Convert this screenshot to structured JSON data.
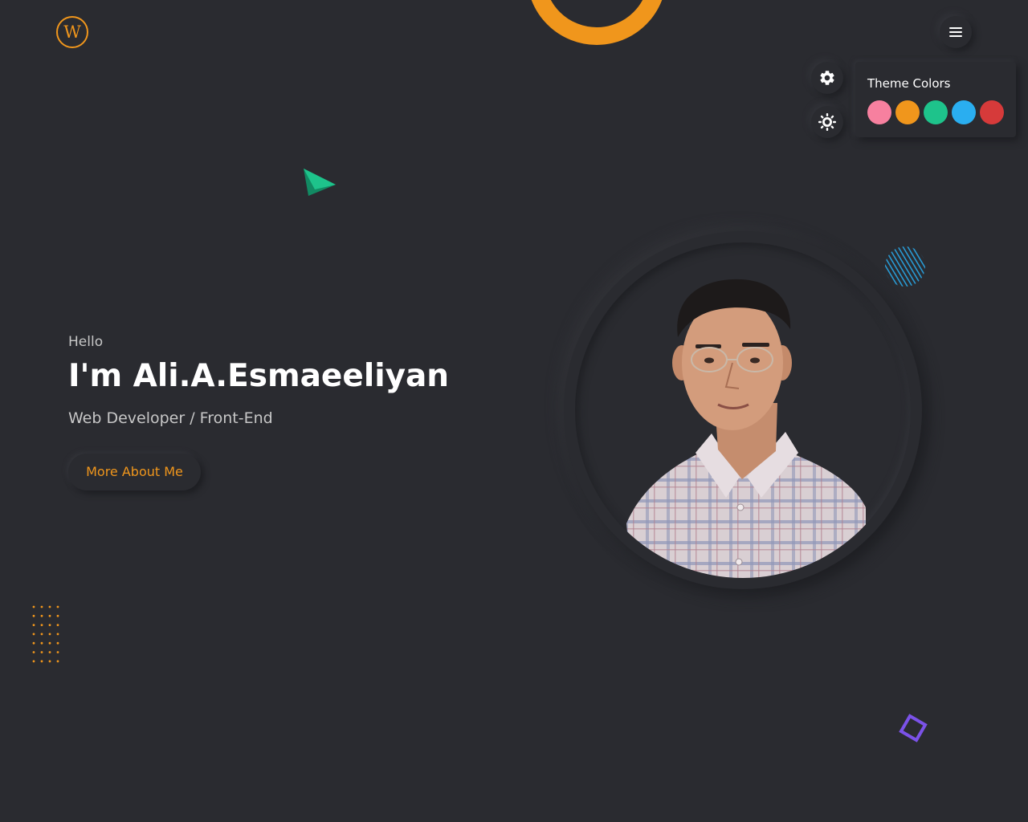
{
  "header": {
    "logo_letter": "W",
    "menu_icon": "hamburger-icon"
  },
  "settings": {
    "settings_icon": "gear-icon",
    "theme_toggle_icon": "sun-icon",
    "theme_panel": {
      "title": "Theme Colors",
      "swatches": [
        {
          "name": "pink",
          "color": "#f7809f"
        },
        {
          "name": "orange",
          "color": "#f0961c"
        },
        {
          "name": "green",
          "color": "#1ec38b"
        },
        {
          "name": "blue",
          "color": "#2aaef0"
        },
        {
          "name": "red",
          "color": "#d63a3a"
        }
      ]
    }
  },
  "hero": {
    "greeting": "Hello",
    "name": "I'm Ali.A.Esmaeeliyan",
    "role": "Web Developer / Front-End",
    "cta_label": "More About Me"
  },
  "colors": {
    "background": "#2a2b30",
    "accent": "#f0961c",
    "text": "#ffffff",
    "muted_text": "#c7c7c7"
  }
}
